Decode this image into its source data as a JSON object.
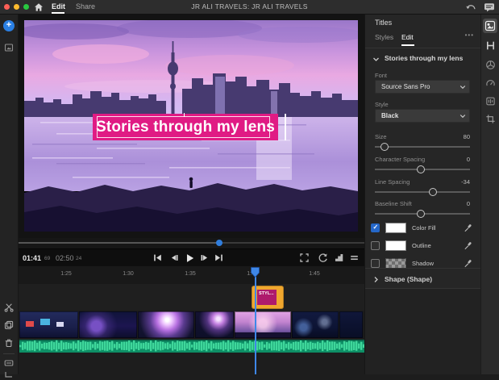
{
  "colors": {
    "accent_blue": "#2f7ddc",
    "banner_pink": "#e01b84",
    "clip_orange": "#f0a72e",
    "clip_magenta": "#ae1a6c",
    "audio_green": "#0e8f66",
    "checkbox_blue": "#2567c8"
  },
  "titlebar": {
    "title": "JR ALI TRAVELS: JR ALI TRAVELS",
    "tabs": [
      {
        "label": "Edit",
        "active": true
      },
      {
        "label": "Share",
        "active": false
      }
    ]
  },
  "preview": {
    "overlay_text": "Stories through my lens"
  },
  "transport": {
    "current_time": "01:41",
    "current_frames": "69",
    "total_time": "02:50",
    "total_frames": "24"
  },
  "timeline": {
    "ruler_ticks": [
      "1:25",
      "1:30",
      "1:35",
      "1:40",
      "1:45"
    ],
    "title_clip_label": "STYL..."
  },
  "panel": {
    "title": "Titles",
    "tabs": [
      {
        "label": "Styles",
        "active": false
      },
      {
        "label": "Edit",
        "active": true
      }
    ],
    "more_label": "•••",
    "section_title": "Stories through my lens",
    "font_label": "Font",
    "font_value": "Source Sans Pro",
    "style_label": "Style",
    "style_value": "Black",
    "sliders": [
      {
        "label": "Size",
        "value": "80",
        "thumb_style": "left:10%"
      },
      {
        "label": "Character Spacing",
        "value": "0",
        "thumb_style": "left:48%"
      },
      {
        "label": "Line Spacing",
        "value": "-34",
        "thumb_style": "left:61%"
      },
      {
        "label": "Baseline Shift",
        "value": "0",
        "thumb_style": "left:48%"
      }
    ],
    "fills": [
      {
        "label": "Color Fill",
        "checked": true,
        "swatch": "white"
      },
      {
        "label": "Outline",
        "checked": false,
        "swatch": "white"
      },
      {
        "label": "Shadow",
        "checked": false,
        "swatch": "checker"
      }
    ],
    "shape_section_title": "Shape (Shape)"
  },
  "icons": {
    "close-icon": "red traffic dot",
    "minimize-icon": "yellow traffic dot",
    "zoom-icon": "green traffic dot",
    "home-icon": "house",
    "undo-icon": "curved arrow",
    "comments-icon": "speech bubble",
    "add-media-icon": "+",
    "media-bin-icon": "image box",
    "split-icon": "scissors",
    "duplicate-icon": "two squares",
    "delete-icon": "trash",
    "track-height-icon": "bars box",
    "expand-tracks-icon": "bracket",
    "skip-back-icon": "|<",
    "step-back-icon": "<|",
    "play-icon": ">",
    "step-forward-icon": "|>",
    "skip-forward-icon": ">|",
    "fullscreen-icon": "corner brackets",
    "loop-icon": "circular arrow",
    "quality-icon": "steps",
    "transport-menu-icon": "lines",
    "chevron-down-icon": "v",
    "chevron-right-icon": ">",
    "eyedropper-icon": "dropper",
    "titles-panel-icon": "graphic box",
    "transitions-panel-icon": "H",
    "color-panel-icon": "color wheel",
    "speed-panel-icon": "gauge",
    "audio-panel-icon": "mixer",
    "crop-panel-icon": "crop marks"
  }
}
